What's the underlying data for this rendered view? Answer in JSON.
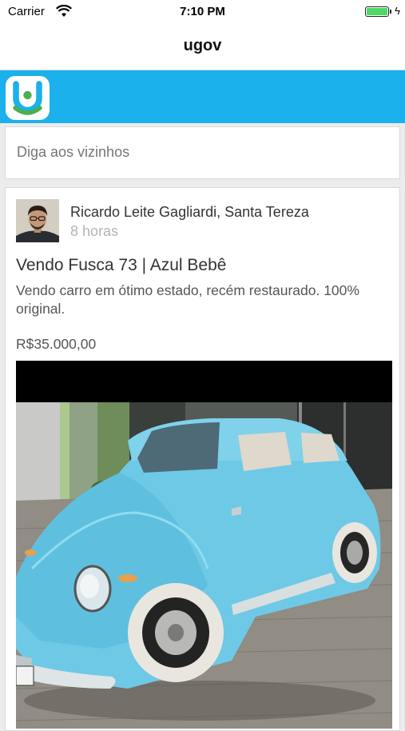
{
  "status_bar": {
    "carrier": "Carrier",
    "time": "7:10 PM",
    "wifi_icon": "wifi-icon",
    "battery_icon": "battery-icon",
    "charging_icon": "bolt-icon",
    "battery_color": "#4cd964"
  },
  "nav": {
    "title": "ugov"
  },
  "brand": {
    "color": "#1ab1ec",
    "logo_icon": "ugov-logo-icon"
  },
  "compose": {
    "placeholder": "Diga aos vizinhos"
  },
  "post": {
    "author": "Ricardo Leite Gagliardi, Santa Tereza",
    "time_ago": "8 horas",
    "title": "Vendo Fusca 73 | Azul Bebê",
    "body": "Vendo carro em ótimo estado, recém restaurado. 100% original.",
    "price": "R$35.000,00",
    "avatar_icon": "avatar-photo",
    "photo_icon": "car-photo"
  }
}
